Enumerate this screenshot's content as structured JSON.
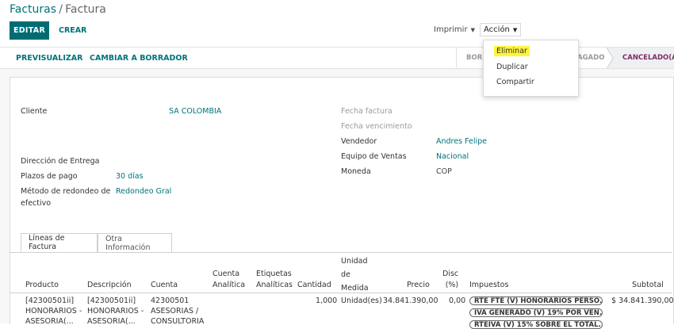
{
  "breadcrumb": {
    "parent": "Facturas",
    "separator": "/",
    "current": "Factura"
  },
  "toolbar": {
    "edit_label": "EDITAR",
    "create_label": "CREAR",
    "print_label": "Imprimir",
    "action_label": "Acción",
    "caret": "▼"
  },
  "action_menu": {
    "items": [
      "Eliminar",
      "Duplicar",
      "Compartir"
    ]
  },
  "status_buttons": {
    "preview": "PREVISUALIZAR",
    "draft": "CAMBIAR A BORRADOR"
  },
  "stages": [
    "BORR",
    "AGADO",
    "CANCELADO(A)"
  ],
  "form": {
    "cliente_label": "Cliente",
    "cliente_value": "SA COLOMBIA",
    "direccion_label": "Dirección de Entrega",
    "plazos_label": "Plazos de pago",
    "plazos_value": "30 días",
    "redondeo_label_1": "Método de redondeo de",
    "redondeo_label_2": "efectivo",
    "redondeo_value": "Redondeo Gral",
    "fecha_factura_label": "Fecha factura",
    "fecha_venc_label": "Fecha vencimiento",
    "vendedor_label": "Vendedor",
    "vendedor_value": "Andres Felipe",
    "equipo_label": "Equipo de Ventas",
    "equipo_value": "Nacional",
    "moneda_label": "Moneda",
    "moneda_value": "COP"
  },
  "tabs": [
    "Líneas de Factura",
    "Otra Información"
  ],
  "table": {
    "headers": {
      "producto": "Producto",
      "descripcion": "Descripción",
      "cuenta": "Cuenta",
      "cuenta_analitica": [
        "Cuenta",
        "Analítica"
      ],
      "etiquetas": [
        "Etiquetas",
        "Analíticas"
      ],
      "cantidad": "Cantidad",
      "unidad": [
        "Unidad",
        "de",
        "Medida"
      ],
      "precio": "Precio",
      "desc": [
        "Disc",
        "(%)"
      ],
      "impuestos": "Impuestos",
      "subtotal": "Subtotal"
    },
    "row": {
      "producto": [
        "[4230050​1ii]",
        "HONORARIOS -",
        "ASESORIA(..."
      ],
      "descripcion": [
        "[4230050​1ii]",
        "HONORARIOS -",
        "ASESORIA(..."
      ],
      "cuenta": [
        "42300501",
        "ASESORIAS /",
        "CONSULTORIA"
      ],
      "cantidad": "1,000",
      "unidad": "Unidad(es)",
      "precio": "34.841.390,00",
      "desc": "0,00",
      "impuestos": [
        "RTE FTE (V) HONORARIOS PERSO...",
        "IVA GENERADO (V) 19% POR VEN...",
        "RTEIVA (V) 15% SOBRE EL TOTAL..."
      ],
      "subtotal": "$ 34.841.390,00"
    }
  },
  "colors": {
    "accent": "#00737a",
    "primary_button": "#016c74",
    "highlight": "#fff53b",
    "cancel_stage": "#7d2c63"
  }
}
